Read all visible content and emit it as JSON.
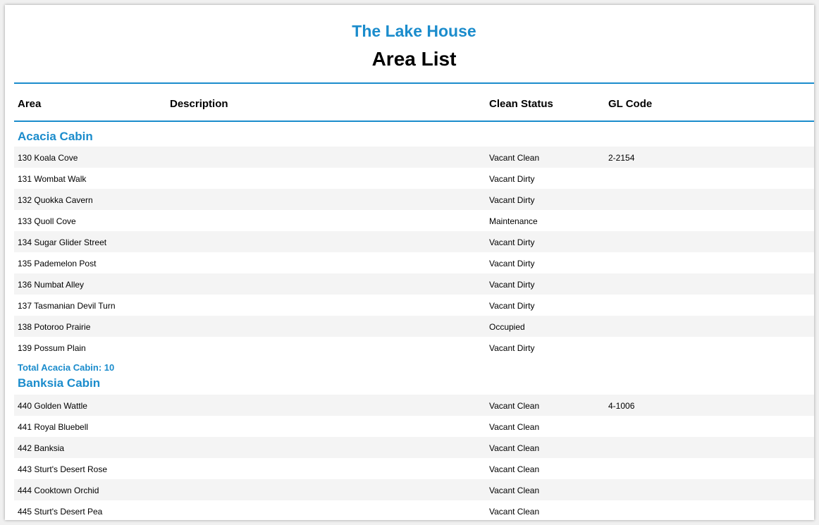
{
  "report": {
    "company": "The Lake House",
    "title": "Area List"
  },
  "columns": {
    "area": "Area",
    "description": "Description",
    "clean_status": "Clean Status",
    "gl_code": "GL Code"
  },
  "groups": [
    {
      "name": "Acacia Cabin",
      "rows": [
        {
          "area": "130 Koala Cove",
          "description": "",
          "clean_status": "Vacant Clean",
          "gl_code": "2-2154"
        },
        {
          "area": "131 Wombat Walk",
          "description": "",
          "clean_status": "Vacant Dirty",
          "gl_code": ""
        },
        {
          "area": "132 Quokka Cavern",
          "description": "",
          "clean_status": "Vacant Dirty",
          "gl_code": ""
        },
        {
          "area": "133 Quoll Cove",
          "description": "",
          "clean_status": "Maintenance",
          "gl_code": ""
        },
        {
          "area": "134 Sugar Glider Street",
          "description": "",
          "clean_status": "Vacant Dirty",
          "gl_code": ""
        },
        {
          "area": "135 Pademelon Post",
          "description": "",
          "clean_status": "Vacant Dirty",
          "gl_code": ""
        },
        {
          "area": "136 Numbat Alley",
          "description": "",
          "clean_status": "Vacant Dirty",
          "gl_code": ""
        },
        {
          "area": "137 Tasmanian Devil Turn",
          "description": "",
          "clean_status": "Vacant Dirty",
          "gl_code": ""
        },
        {
          "area": "138 Potoroo Prairie",
          "description": "",
          "clean_status": "Occupied",
          "gl_code": ""
        },
        {
          "area": "139 Possum Plain",
          "description": "",
          "clean_status": "Vacant Dirty",
          "gl_code": ""
        }
      ],
      "total": "Total Acacia Cabin: 10"
    },
    {
      "name": "Banksia Cabin",
      "rows": [
        {
          "area": "440 Golden Wattle",
          "description": "",
          "clean_status": "Vacant Clean",
          "gl_code": "4-1006"
        },
        {
          "area": "441 Royal Bluebell",
          "description": "",
          "clean_status": "Vacant Clean",
          "gl_code": ""
        },
        {
          "area": "442 Banksia",
          "description": "",
          "clean_status": "Vacant Clean",
          "gl_code": ""
        },
        {
          "area": "443 Sturt's Desert Rose",
          "description": "",
          "clean_status": "Vacant Clean",
          "gl_code": ""
        },
        {
          "area": "444 Cooktown Orchid",
          "description": "",
          "clean_status": "Vacant Clean",
          "gl_code": ""
        },
        {
          "area": "445 Sturt's Desert Pea",
          "description": "",
          "clean_status": "Vacant Clean",
          "gl_code": ""
        }
      ]
    }
  ],
  "colors": {
    "accent": "#1b8ccc",
    "row_alt": "#f4f4f4"
  }
}
